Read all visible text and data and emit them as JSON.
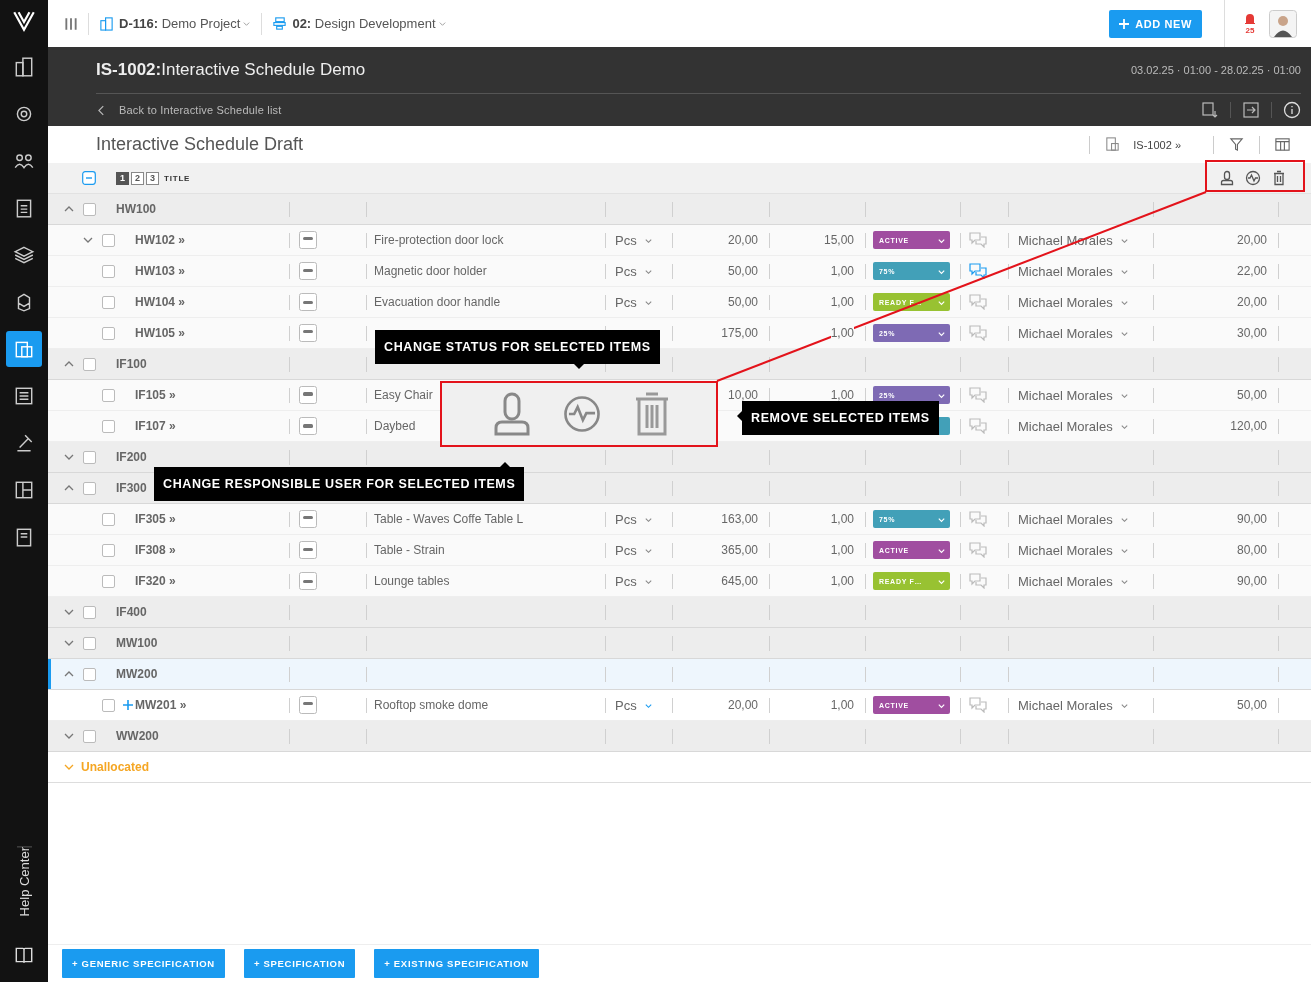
{
  "sidebar": {
    "items": [
      {
        "selected": false
      },
      {
        "selected": false
      },
      {
        "selected": false
      },
      {
        "selected": false
      },
      {
        "selected": false
      },
      {
        "selected": false
      },
      {
        "selected": true
      },
      {
        "selected": false
      },
      {
        "selected": false
      },
      {
        "selected": false
      },
      {
        "selected": false
      }
    ],
    "help_label": "Help Center"
  },
  "topbar": {
    "project": {
      "code": "D-116:",
      "name": "Demo Project"
    },
    "phase": {
      "code": "02:",
      "name": "Design Development"
    },
    "add_button": "ADD NEW",
    "notification_count": "25"
  },
  "header": {
    "code": "IS-1002:",
    "title": "Interactive Schedule Demo",
    "dates": "03.02.25 · 01:00 - 28.02.25 · 01:00",
    "back_link": "Back to Interactive Schedule list"
  },
  "subheader": {
    "title": "Interactive Schedule Draft",
    "reference": "IS-1002 »"
  },
  "table": {
    "header_checkbox_partial": true,
    "levels": [
      {
        "label": "1",
        "selected": true
      },
      {
        "label": "2",
        "selected": false
      },
      {
        "label": "3",
        "selected": false
      }
    ],
    "title_column": "TITLE",
    "groups": [
      {
        "code": "HW100",
        "expanded": true,
        "selected": false,
        "checked": false,
        "children": [
          {
            "code": "HW102 »",
            "expanded": false,
            "checked": false,
            "show_add": false,
            "description": "Fire-protection door lock",
            "unit": "Pcs",
            "qty": "20,00",
            "price": "15,00",
            "status": {
              "label": "ACTIVE",
              "color": "#a04ea0"
            },
            "has_comments": false,
            "user": "Michael Morales",
            "total": "20,00"
          },
          {
            "code": "HW103 »",
            "checked": false,
            "show_add": false,
            "description": "Magnetic door holder",
            "unit": "Pcs",
            "qty": "50,00",
            "price": "1,00",
            "status": {
              "label": "75%",
              "color": "#42a0b8"
            },
            "has_comments": true,
            "user": "Michael Morales",
            "total": "22,00"
          },
          {
            "code": "HW104 »",
            "checked": false,
            "show_add": false,
            "description": "Evacuation door handle",
            "unit": "Pcs",
            "qty": "50,00",
            "price": "1,00",
            "status": {
              "label": "READY F…",
              "color": "#98c232"
            },
            "has_comments": false,
            "user": "Michael Morales",
            "total": "20,00"
          },
          {
            "code": "HW105 »",
            "checked": false,
            "show_add": false,
            "qty": "175,00",
            "price": "1,00",
            "status": {
              "label": "25%",
              "color": "#7e6ab4"
            },
            "has_comments": false,
            "user": "Michael Morales",
            "total": "30,00"
          }
        ]
      },
      {
        "code": "IF100",
        "expanded": true,
        "selected": false,
        "checked": false,
        "children": [
          {
            "code": "IF105 »",
            "checked": false,
            "show_add": false,
            "description": "Easy Chair",
            "qty": "10,00",
            "price": "1,00",
            "status": {
              "label": "25%",
              "color": "#7e6ab4"
            },
            "has_comments": false,
            "user": "Michael Morales",
            "total": "50,00"
          },
          {
            "code": "IF107 »",
            "checked": false,
            "show_add": false,
            "description": "Daybed",
            "status": {
              "color": "#42a0b8"
            },
            "has_comments": false,
            "user": "Michael Morales",
            "total": "120,00"
          }
        ]
      },
      {
        "code": "IF200",
        "expanded": false,
        "selected": false,
        "checked": false
      },
      {
        "code": "IF300",
        "expanded": true,
        "selected": false,
        "checked": false,
        "children": [
          {
            "code": "IF305 »",
            "checked": false,
            "show_add": false,
            "description": "Table - Waves Coffe Table L",
            "unit": "Pcs",
            "qty": "163,00",
            "price": "1,00",
            "status": {
              "label": "75%",
              "color": "#42a0b8"
            },
            "has_comments": false,
            "user": "Michael Morales",
            "total": "90,00"
          },
          {
            "code": "IF308 »",
            "checked": false,
            "show_add": false,
            "description": "Table - Strain",
            "unit": "Pcs",
            "qty": "365,00",
            "price": "1,00",
            "status": {
              "label": "ACTIVE",
              "color": "#a04ea0"
            },
            "has_comments": false,
            "user": "Michael Morales",
            "total": "80,00"
          },
          {
            "code": "IF320 »",
            "checked": false,
            "show_add": false,
            "description": "Lounge tables",
            "unit": "Pcs",
            "qty": "645,00",
            "price": "1,00",
            "status": {
              "label": "READY F…",
              "color": "#98c232"
            },
            "has_comments": false,
            "user": "Michael Morales",
            "total": "90,00"
          }
        ]
      },
      {
        "code": "IF400",
        "expanded": false,
        "selected": false,
        "checked": false
      },
      {
        "code": "MW100",
        "expanded": false,
        "selected": false,
        "checked": false
      },
      {
        "code": "MW200",
        "expanded": true,
        "selected": true,
        "checked": false,
        "children": [
          {
            "code": "MW201 »",
            "checked": false,
            "show_add": true,
            "description": "Rooftop smoke dome",
            "unit": "Pcs",
            "qty": "20,00",
            "price": "1,00",
            "status": {
              "label": "ACTIVE",
              "color": "#a04ea0"
            },
            "has_comments": false,
            "user": "Michael Morales",
            "total": "50,00"
          }
        ]
      },
      {
        "code": "WW200",
        "expanded": false,
        "selected": false,
        "checked": false
      }
    ],
    "unallocated": {
      "label": "Unallocated",
      "expanded": false
    }
  },
  "annotations": {
    "tooltips": [
      {
        "text": "CHANGE STATUS FOR SELECTED ITEMS"
      },
      {
        "text": "REMOVE SELECTED ITEMS"
      },
      {
        "text": "CHANGE RESPONSIBLE USER FOR SELECTED ITEMS"
      }
    ]
  },
  "footer": {
    "buttons": [
      "+ GENERIC SPECIFICATION",
      "+ SPECIFICATION",
      "+ EXISTING SPECIFICATION"
    ]
  }
}
